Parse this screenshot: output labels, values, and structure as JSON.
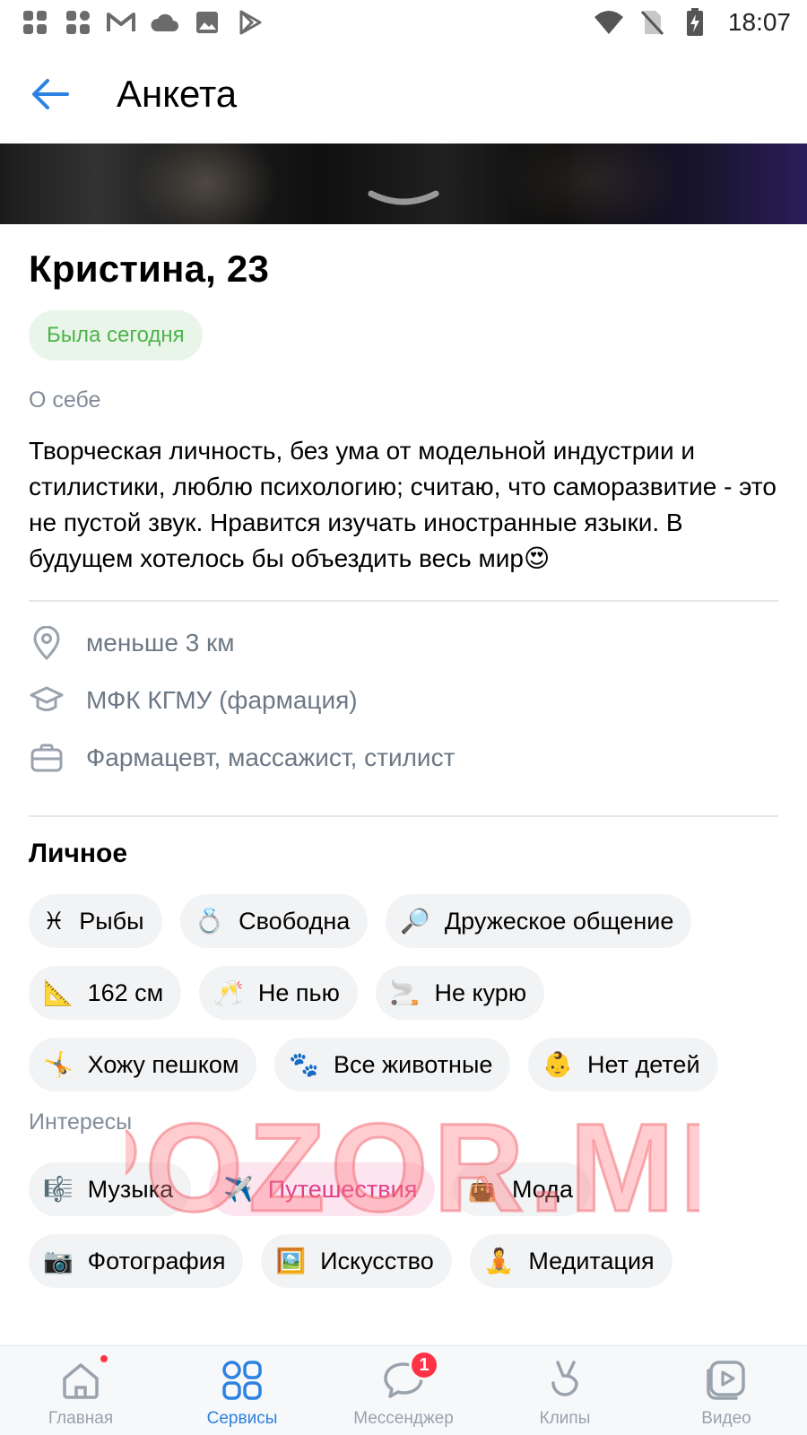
{
  "status_bar": {
    "time": "18:07"
  },
  "header": {
    "title": "Анкета"
  },
  "profile": {
    "name_age": "Кристина, 23",
    "online_status": "Была сегодня",
    "about_label": "О себе",
    "about_text": "Творческая личность, без ума от модельной индустрии и стилистики, люблю психологию; считаю, что саморазвитие - это не пустой звук. Нравится изучать иностранные языки. В будущем хотелось бы объездить весь мир😍",
    "info": {
      "distance": "меньше 3 км",
      "education": "МФК КГМУ (фармация)",
      "work": "Фармацевт, массажист, стилист"
    },
    "personal_title": "Личное",
    "personal": [
      {
        "icon": "♓",
        "label": "Рыбы"
      },
      {
        "icon": "💍",
        "label": "Свободна"
      },
      {
        "icon": "🔎",
        "label": "Дружеское общение"
      },
      {
        "icon": "📐",
        "label": "162 см"
      },
      {
        "icon": "🥂",
        "label": "Не пью"
      },
      {
        "icon": "🚬",
        "label": "Не курю"
      },
      {
        "icon": "🤸",
        "label": "Хожу пешком"
      },
      {
        "icon": "🐾",
        "label": "Все животные"
      },
      {
        "icon": "👶",
        "label": "Нет детей"
      }
    ],
    "interests_label": "Интересы",
    "interests": [
      {
        "icon": "🎼",
        "label": "Музыка"
      },
      {
        "icon": "✈️",
        "label": "Путешествия"
      },
      {
        "icon": "👜",
        "label": "Мода"
      },
      {
        "icon": "📷",
        "label": "Фотография"
      },
      {
        "icon": "🖼️",
        "label": "Искусство"
      },
      {
        "icon": "🧘",
        "label": "Медитация"
      }
    ]
  },
  "watermark": "POZOR.ME",
  "bottom_nav": {
    "items": [
      {
        "label": "Главная"
      },
      {
        "label": "Сервисы"
      },
      {
        "label": "Мессенджер",
        "badge": "1"
      },
      {
        "label": "Клипы"
      },
      {
        "label": "Видео"
      }
    ]
  },
  "colors": {
    "accent": "#2d81e0",
    "online": "#4bb34b",
    "highlight": "#e0408a",
    "badge": "#ff3347"
  }
}
